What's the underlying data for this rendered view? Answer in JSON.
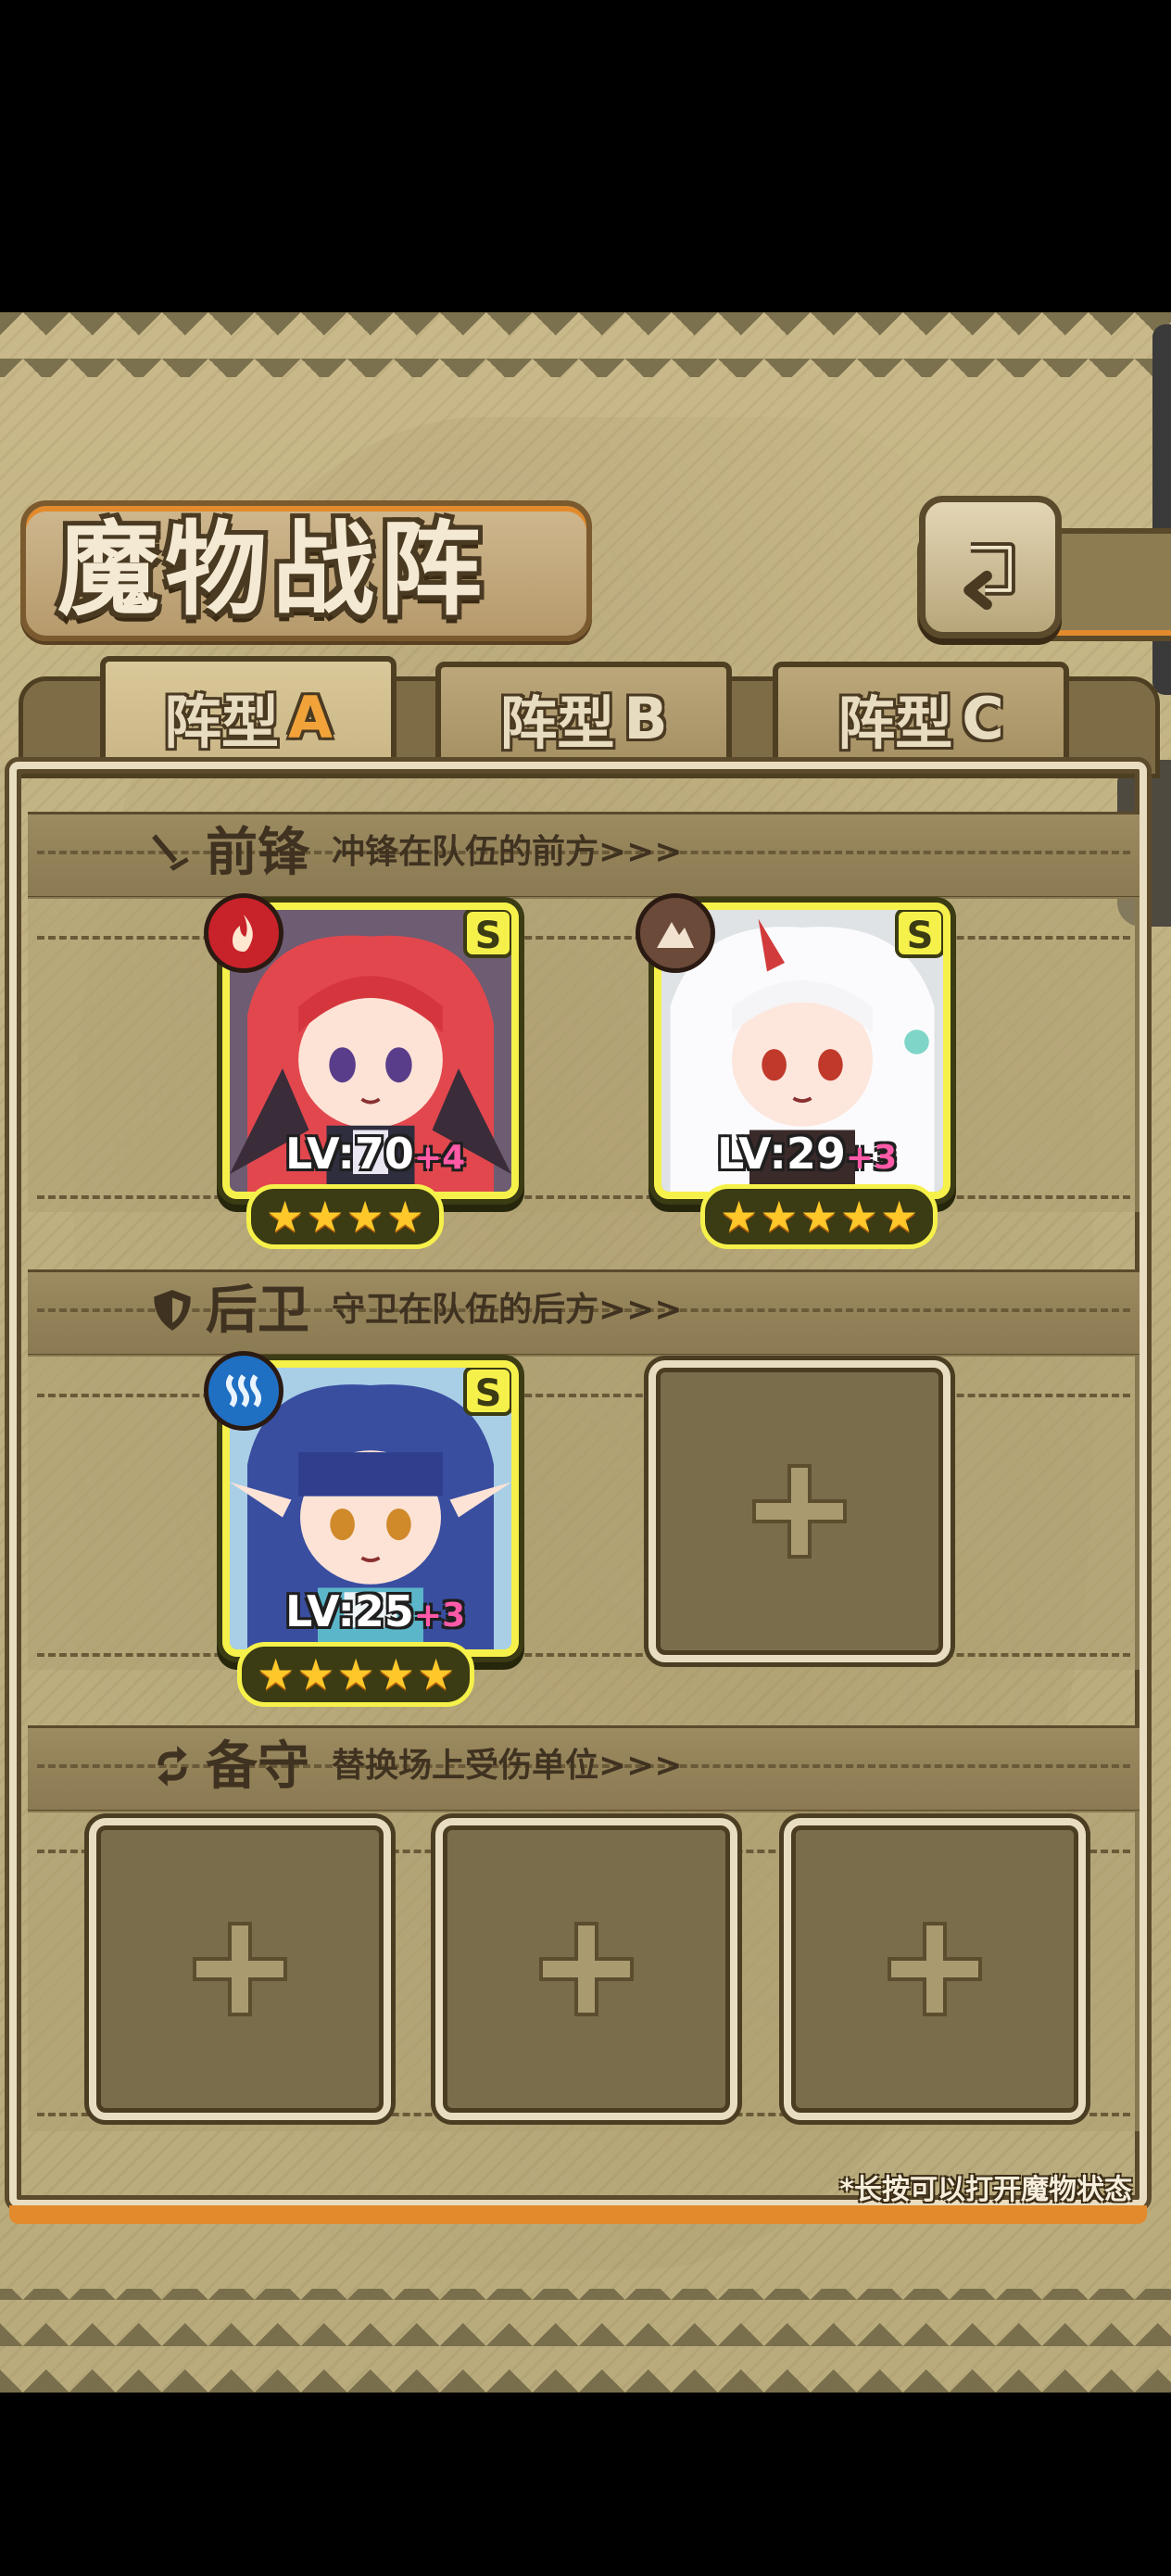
{
  "screen": {
    "title": "魔物战阵",
    "back_button": "back"
  },
  "tabs": [
    {
      "prefix": "阵型",
      "suffix": "A",
      "active": true
    },
    {
      "prefix": "阵型",
      "suffix": "B",
      "active": false
    },
    {
      "prefix": "阵型",
      "suffix": "C",
      "active": false
    }
  ],
  "sections": {
    "vanguard": {
      "name": "前锋",
      "desc": "冲锋在队伍的前方>>>",
      "icon": "sword-icon"
    },
    "rearguard": {
      "name": "后卫",
      "desc": "守卫在队伍的后方>>>",
      "icon": "shield-icon"
    },
    "reserve": {
      "name": "备守",
      "desc": "替换场上受伤单位>>>",
      "icon": "swap-icon"
    }
  },
  "monsters": [
    {
      "slot": "vanguard-1",
      "rank": "S",
      "level": "LV:70",
      "bonus": "+4",
      "stars": 4,
      "element": "fire-icon",
      "element_color": "#c8222a"
    },
    {
      "slot": "vanguard-2",
      "rank": "S",
      "level": "LV:29",
      "bonus": "+3",
      "stars": 5,
      "element": "earth-icon",
      "element_color": "#6b4a3a"
    },
    {
      "slot": "rearguard-1",
      "rank": "S",
      "level": "LV:25",
      "bonus": "+3",
      "stars": 5,
      "element": "water-icon",
      "element_color": "#1f6fc2"
    }
  ],
  "empty_slots": [
    "rearguard-2",
    "reserve-1",
    "reserve-2",
    "reserve-3"
  ],
  "footnote": "*长按可以打开魔物状态",
  "colors": {
    "card_border": "#f6f14a",
    "accent_orange": "#e38a2c",
    "bonus_pink": "#ff5aa8",
    "star": "#ffc82a"
  }
}
